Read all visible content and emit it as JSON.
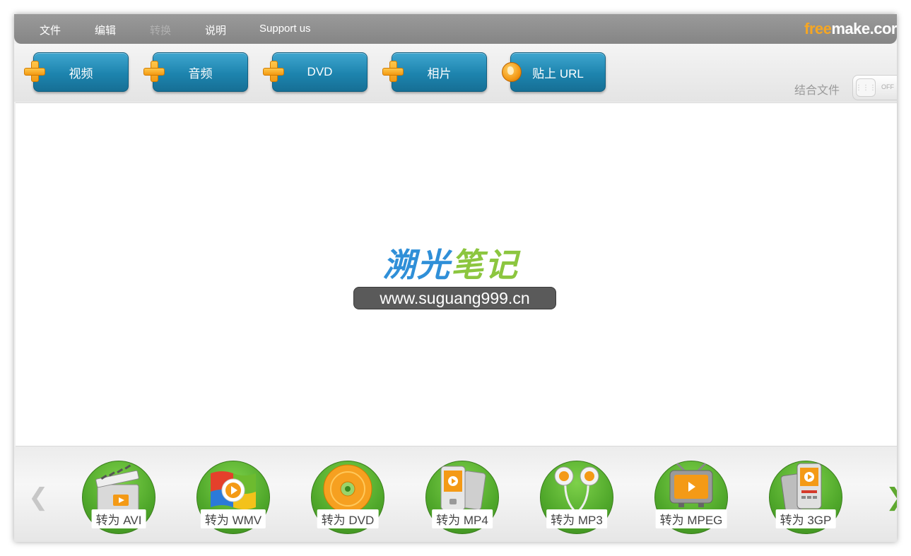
{
  "menu": {
    "items": [
      {
        "label": "文件",
        "enabled": true
      },
      {
        "label": "编辑",
        "enabled": true
      },
      {
        "label": "转换",
        "enabled": false
      },
      {
        "label": "说明",
        "enabled": true
      },
      {
        "label": "Support us",
        "enabled": true
      }
    ],
    "logo_free": "free",
    "logo_rest": "make.cor"
  },
  "toolbar": {
    "buttons": [
      {
        "label": "视频",
        "icon": "plus-icon"
      },
      {
        "label": "音频",
        "icon": "plus-icon"
      },
      {
        "label": "DVD",
        "icon": "plus-icon"
      },
      {
        "label": "相片",
        "icon": "plus-icon"
      },
      {
        "label": "贴上 URL",
        "icon": "globe-icon"
      }
    ],
    "merge_label": "结合文件",
    "merge_toggle_text": "OFF"
  },
  "watermark": {
    "title_part1": "溯光",
    "title_part2": "笔记",
    "url": "www.suguang999.cn"
  },
  "formats": [
    {
      "label": "转为 AVI",
      "icon": "clapperboard-icon"
    },
    {
      "label": "转为 WMV",
      "icon": "windows-media-icon"
    },
    {
      "label": "转为 DVD",
      "icon": "dvd-disc-icon"
    },
    {
      "label": "转为 MP4",
      "icon": "media-player-icon"
    },
    {
      "label": "转为 MP3",
      "icon": "earphones-icon"
    },
    {
      "label": "转为 MPEG",
      "icon": "tv-icon"
    },
    {
      "label": "转为 3GP",
      "icon": "mobile-phone-icon"
    }
  ],
  "colors": {
    "button_blue": "#1d84ae",
    "format_green": "#4fa72a",
    "accent_orange": "#f5a623"
  }
}
